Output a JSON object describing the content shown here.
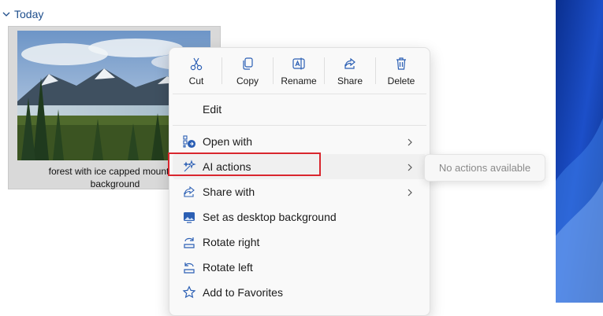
{
  "group": {
    "label": "Today",
    "icon": "chevron-down-icon"
  },
  "file": {
    "name_line1": "forest with ice capped mountain",
    "name_line2": "background"
  },
  "context_menu": {
    "quick_actions": [
      {
        "label": "Cut",
        "icon": "scissors-icon"
      },
      {
        "label": "Copy",
        "icon": "copy-icon"
      },
      {
        "label": "Rename",
        "icon": "rename-icon"
      },
      {
        "label": "Share",
        "icon": "share-icon"
      },
      {
        "label": "Delete",
        "icon": "trash-icon"
      }
    ],
    "edit_label": "Edit",
    "items": [
      {
        "label": "Open with",
        "icon": "open-with-icon",
        "submenu": true
      },
      {
        "label": "AI actions",
        "icon": "sparkle-icon",
        "submenu": true
      },
      {
        "label": "Share with",
        "icon": "share-with-icon",
        "submenu": true
      },
      {
        "label": "Set as desktop background",
        "icon": "desktop-background-icon",
        "submenu": false
      },
      {
        "label": "Rotate right",
        "icon": "rotate-right-icon",
        "submenu": false
      },
      {
        "label": "Rotate left",
        "icon": "rotate-left-icon",
        "submenu": false
      },
      {
        "label": "Add to Favorites",
        "icon": "star-icon",
        "submenu": false
      }
    ]
  },
  "submenu": {
    "message": "No actions available"
  },
  "colors": {
    "highlight": "#d9262e",
    "accent": "#1e4e8c",
    "icon_blue": "#2b5fb4"
  }
}
